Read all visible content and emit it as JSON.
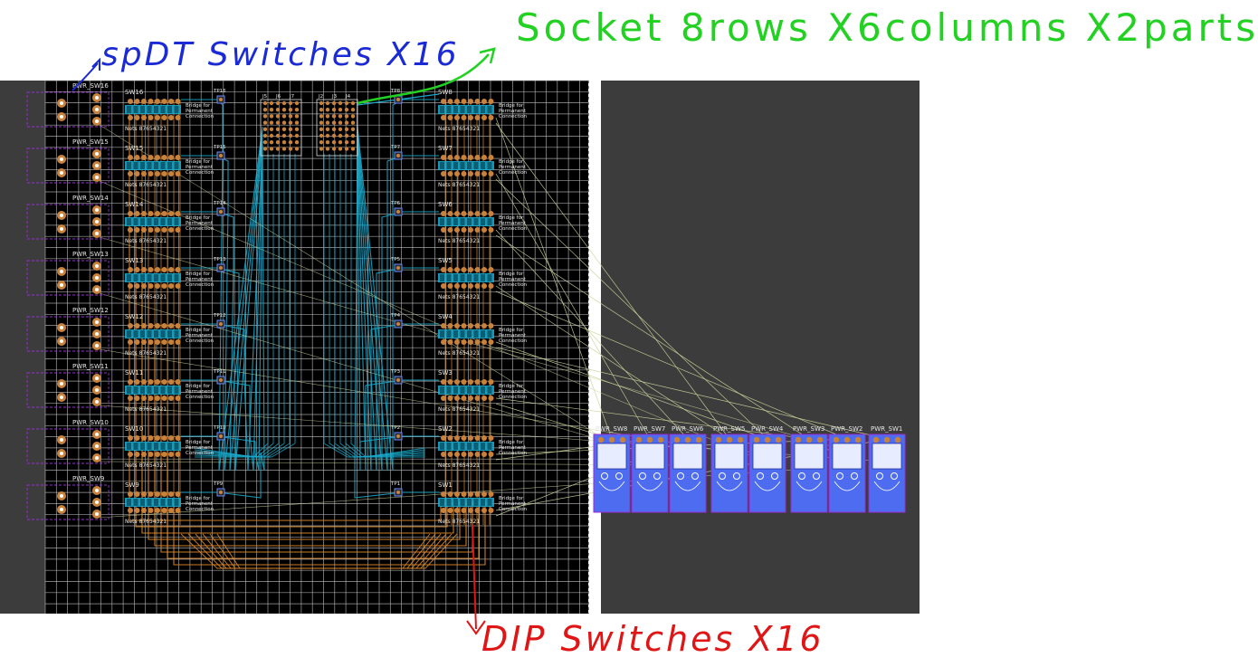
{
  "annotations": {
    "spdt": "spDT Switches X16",
    "socket": "Socket 8rows X6columns X2parts",
    "dip": "DIP Switches X16"
  },
  "colors": {
    "board_bg": "#000000",
    "canvas_bg": "#3c3c3c",
    "grid": "#bcbcbc",
    "copper_top": "#1aa7c9",
    "copper_bottom": "#e08a2a",
    "pad": "#c8823c",
    "ratsnest": "#c9d29a",
    "component_body": "#4e6cf0",
    "outline": "#9b2bd6",
    "annotation_spdt": "#1a2bd6",
    "annotation_socket": "#22d122",
    "annotation_dip": "#e01616"
  },
  "left_switches": [
    "PWR_SW16",
    "PWR_SW15",
    "PWR_SW14",
    "PWR_SW13",
    "PWR_SW12",
    "PWR_SW11",
    "PWR_SW10",
    "PWR_SW9"
  ],
  "left_dips": [
    "SW16",
    "SW15",
    "SW14",
    "SW13",
    "SW12",
    "SW11",
    "SW10",
    "SW9"
  ],
  "left_testpoints": [
    "TP16",
    "TP15",
    "TP14",
    "TP13",
    "TP12",
    "TP11",
    "TP10",
    "TP9"
  ],
  "right_dips": [
    "SW8",
    "SW7",
    "SW6",
    "SW5",
    "SW4",
    "SW3",
    "SW2",
    "SW1"
  ],
  "right_testpoints": [
    "TP8",
    "TP7",
    "TP6",
    "TP5",
    "TP4",
    "TP3",
    "TP2",
    "TP1"
  ],
  "sockets_left": [
    "J5",
    "J6",
    "J7"
  ],
  "sockets_right": [
    "J2",
    "J3",
    "J4"
  ],
  "bridge_label": [
    "Bridge for",
    "Permanent",
    "Connection"
  ],
  "nets_label": "Nets 87654321",
  "bottom_switches": [
    "PWR_SW8",
    "PWR_SW7",
    "PWR_SW6",
    "PWR_SW5",
    "PWR_SW4",
    "PWR_SW3",
    "PWR_SW2",
    "PWR_SW1"
  ]
}
